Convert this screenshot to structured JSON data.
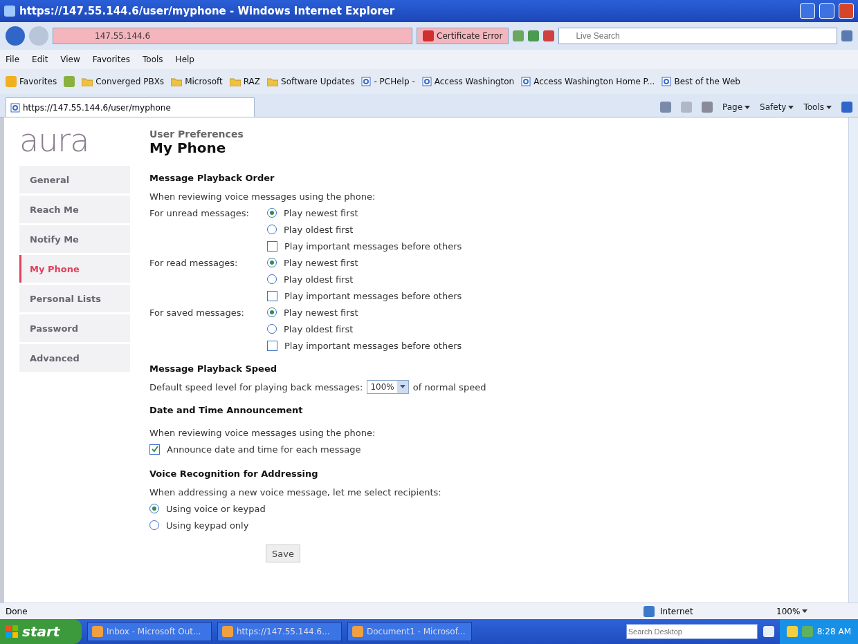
{
  "window": {
    "title": "https://147.55.144.6/user/myphone - Windows Internet Explorer"
  },
  "address_bar": {
    "address": "147.55.144.6",
    "certificate": "Certificate Error",
    "search_placeholder": "Live Search"
  },
  "menu": [
    "File",
    "Edit",
    "View",
    "Favorites",
    "Tools",
    "Help"
  ],
  "favorites_bar": {
    "label": "Favorites",
    "items": [
      {
        "kind": "folder",
        "label": "Converged PBXs"
      },
      {
        "kind": "folder",
        "label": "Microsoft"
      },
      {
        "kind": "folder",
        "label": "RAZ"
      },
      {
        "kind": "folder",
        "label": "Software Updates"
      },
      {
        "kind": "page",
        "label": "- PCHelp -"
      },
      {
        "kind": "page",
        "label": "Access Washington"
      },
      {
        "kind": "page",
        "label": "Access Washington Home P..."
      },
      {
        "kind": "page",
        "label": "Best of the Web"
      }
    ]
  },
  "tab": {
    "title": "https://147.55.144.6/user/myphone"
  },
  "command_bar": [
    "Page",
    "Safety",
    "Tools"
  ],
  "page": {
    "logo": "aura",
    "sidebar": [
      {
        "label": "General",
        "selected": false
      },
      {
        "label": "Reach Me",
        "selected": false
      },
      {
        "label": "Notify Me",
        "selected": false
      },
      {
        "label": "My Phone",
        "selected": true
      },
      {
        "label": "Personal Lists",
        "selected": false
      },
      {
        "label": "Password",
        "selected": false
      },
      {
        "label": "Advanced",
        "selected": false
      }
    ],
    "breadcrumb": "User Preferences",
    "title": "My Phone",
    "playback_order": {
      "heading": "Message Playback Order",
      "intro": "When reviewing voice messages using the phone:",
      "groups": [
        {
          "label": "For unread messages:",
          "options": [
            {
              "kind": "radio",
              "label": "Play newest first",
              "selected": true
            },
            {
              "kind": "radio",
              "label": "Play oldest first",
              "selected": false
            },
            {
              "kind": "checkbox",
              "label": "Play important messages before others",
              "checked": false
            }
          ]
        },
        {
          "label": "For read messages:",
          "options": [
            {
              "kind": "radio",
              "label": "Play newest first",
              "selected": true
            },
            {
              "kind": "radio",
              "label": "Play oldest first",
              "selected": false
            },
            {
              "kind": "checkbox",
              "label": "Play important messages before others",
              "checked": false
            }
          ]
        },
        {
          "label": "For saved messages:",
          "options": [
            {
              "kind": "radio",
              "label": "Play newest first",
              "selected": true
            },
            {
              "kind": "radio",
              "label": "Play oldest first",
              "selected": false
            },
            {
              "kind": "checkbox",
              "label": "Play important messages before others",
              "checked": false
            }
          ]
        }
      ]
    },
    "playback_speed": {
      "heading": "Message Playback Speed",
      "label": "Default speed level for playing back messages:",
      "value": "100%",
      "suffix": "of normal speed"
    },
    "date_time": {
      "heading": "Date and Time Announcement",
      "intro": "When reviewing voice messages using the phone:",
      "option": {
        "label": "Announce date and time for each message",
        "checked": true
      }
    },
    "voice_recognition": {
      "heading": "Voice Recognition for Addressing",
      "intro": "When addressing a new voice message, let me select recipients:",
      "options": [
        {
          "label": "Using voice or keypad",
          "selected": true
        },
        {
          "label": "Using keypad only",
          "selected": false
        }
      ]
    },
    "save": "Save"
  },
  "status_bar": {
    "status": "Done",
    "zone": "Internet",
    "zoom": "100%"
  },
  "taskbar": {
    "start": "start",
    "tasks": [
      "Inbox - Microsoft Out...",
      "https://147.55.144.6...",
      "Document1 - Microsof..."
    ],
    "search_placeholder": "Search Desktop",
    "clock": "8:28 AM"
  }
}
